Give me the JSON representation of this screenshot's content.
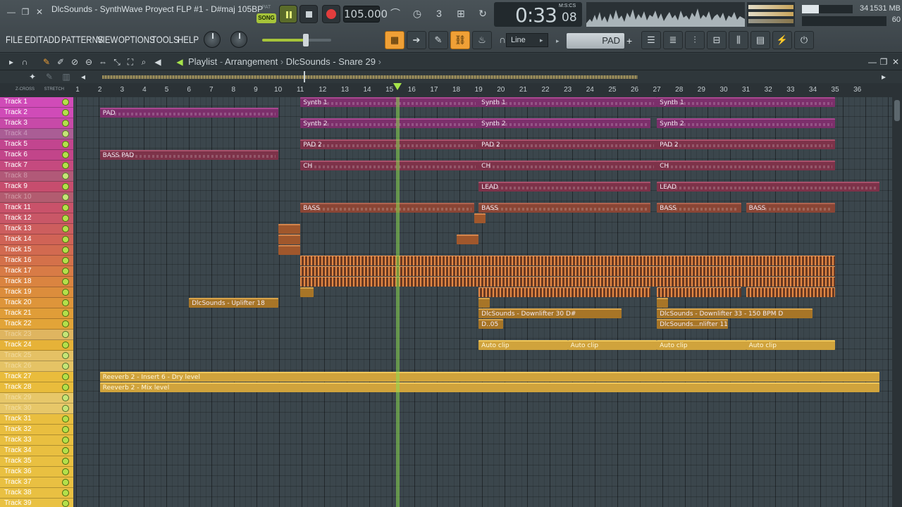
{
  "window": {
    "title": "DlcSounds - SynthWave Proyect FLP #1 - D#maj 105BP",
    "min_icon": "minimize-icon",
    "restore_icon": "restore-icon",
    "close_icon": "close-icon"
  },
  "transport": {
    "pat_label": "PAT",
    "song_label": "SONG",
    "tempo": "105.000",
    "time": "0:33",
    "time_frac": "08",
    "time_unit": "M:S:CS"
  },
  "stats": {
    "cpu": "34",
    "cpu_fill": 0.34,
    "memory": "1531 MB",
    "polyphony": "60"
  },
  "menu": [
    "FILE",
    "EDIT",
    "ADD",
    "PATTERNS",
    "VIEW",
    "OPTIONS",
    "TOOLS",
    "HELP"
  ],
  "toolbar": {
    "snap": "Line",
    "pattern": "PAD",
    "pattern_plus": "+"
  },
  "playlist": {
    "title": "Playlist",
    "section": "Arrangement",
    "selected": "DlcSounds - Snare 29",
    "ruler_labels": [
      "Z-CROSS",
      "STRETCH"
    ]
  },
  "ruler": [
    "1",
    "2",
    "3",
    "4",
    "5",
    "6",
    "7",
    "8",
    "9",
    "10",
    "11",
    "12",
    "13",
    "14",
    "15",
    "16",
    "17",
    "18",
    "19",
    "20",
    "21",
    "22",
    "23",
    "24",
    "25",
    "26",
    "27",
    "28",
    "29",
    "30",
    "31",
    "32",
    "33",
    "34",
    "35",
    "36"
  ],
  "tracks": [
    {
      "name": "Track 1",
      "color": "#d04bb8",
      "dim": false
    },
    {
      "name": "Track 2",
      "color": "#d04bb8",
      "dim": false
    },
    {
      "name": "Track 3",
      "color": "#c74aa8",
      "dim": false
    },
    {
      "name": "Track 4",
      "color": "#b9509c",
      "dim": true
    },
    {
      "name": "Track 5",
      "color": "#c2458f",
      "dim": false
    },
    {
      "name": "Track 6",
      "color": "#c2458a",
      "dim": false
    },
    {
      "name": "Track 7",
      "color": "#c54a7f",
      "dim": false
    },
    {
      "name": "Track 8",
      "color": "#c44c76",
      "dim": true
    },
    {
      "name": "Track 9",
      "color": "#c74d6e",
      "dim": false
    },
    {
      "name": "Track 10",
      "color": "#c5506a",
      "dim": true
    },
    {
      "name": "Track 11",
      "color": "#c9526a",
      "dim": false
    },
    {
      "name": "Track 12",
      "color": "#c95767",
      "dim": false
    },
    {
      "name": "Track 13",
      "color": "#cd5e5e",
      "dim": false
    },
    {
      "name": "Track 14",
      "color": "#d06356",
      "dim": false
    },
    {
      "name": "Track 15",
      "color": "#d26a50",
      "dim": false
    },
    {
      "name": "Track 16",
      "color": "#d4714a",
      "dim": false
    },
    {
      "name": "Track 17",
      "color": "#d87b46",
      "dim": false
    },
    {
      "name": "Track 18",
      "color": "#da8440",
      "dim": false
    },
    {
      "name": "Track 19",
      "color": "#dc8d3c",
      "dim": false
    },
    {
      "name": "Track 20",
      "color": "#de953a",
      "dim": false
    },
    {
      "name": "Track 21",
      "color": "#e09d38",
      "dim": false
    },
    {
      "name": "Track 22",
      "color": "#e2a438",
      "dim": false
    },
    {
      "name": "Track 23",
      "color": "#e4ab38",
      "dim": true
    },
    {
      "name": "Track 24",
      "color": "#e6b238",
      "dim": false
    },
    {
      "name": "Track 25",
      "color": "#e8b73a",
      "dim": true
    },
    {
      "name": "Track 26",
      "color": "#e8b93a",
      "dim": true
    },
    {
      "name": "Track 27",
      "color": "#e9bc3c",
      "dim": false
    },
    {
      "name": "Track 28",
      "color": "#e9bc3c",
      "dim": false
    },
    {
      "name": "Track 29",
      "color": "#e9bd3e",
      "dim": true
    },
    {
      "name": "Track 30",
      "color": "#e9bd3e",
      "dim": true
    },
    {
      "name": "Track 31",
      "color": "#e9be3f",
      "dim": false
    },
    {
      "name": "Track 32",
      "color": "#e9be3f",
      "dim": false
    },
    {
      "name": "Track 33",
      "color": "#e9bf40",
      "dim": false
    },
    {
      "name": "Track 34",
      "color": "#e9bf40",
      "dim": false
    },
    {
      "name": "Track 35",
      "color": "#e9c041",
      "dim": false
    },
    {
      "name": "Track 36",
      "color": "#e9c041",
      "dim": false
    },
    {
      "name": "Track 37",
      "color": "#e9c042",
      "dim": false
    },
    {
      "name": "Track 38",
      "color": "#e9c042",
      "dim": false
    },
    {
      "name": "Track 39",
      "color": "#e9c143",
      "dim": false
    }
  ],
  "clips": [
    {
      "track": 0,
      "start": 11,
      "end": 19,
      "label": "Synth 1",
      "style": "pink notes"
    },
    {
      "track": 0,
      "start": 19,
      "end": 27,
      "label": "Synth 1",
      "style": "pink notes"
    },
    {
      "track": 0,
      "start": 27,
      "end": 35,
      "label": "Synth 1",
      "style": "pink notes"
    },
    {
      "track": 1,
      "start": 2,
      "end": 10,
      "label": "PAD",
      "style": "pink notes"
    },
    {
      "track": 2,
      "start": 11,
      "end": 19,
      "label": "Synth 2",
      "style": "pink notes"
    },
    {
      "track": 2,
      "start": 19,
      "end": 26.7,
      "label": "Synth 2",
      "style": "pink notes"
    },
    {
      "track": 2,
      "start": 27,
      "end": 35,
      "label": "Synth 2",
      "style": "pink notes"
    },
    {
      "track": 4,
      "start": 11,
      "end": 19,
      "label": "PAD 2",
      "style": "rose notes"
    },
    {
      "track": 4,
      "start": 19,
      "end": 27,
      "label": "PAD 2",
      "style": "rose notes"
    },
    {
      "track": 4,
      "start": 27,
      "end": 35,
      "label": "PAD 2",
      "style": "rose notes"
    },
    {
      "track": 5,
      "start": 2,
      "end": 10,
      "label": "BASS PAD",
      "style": "rose notes"
    },
    {
      "track": 6,
      "start": 11,
      "end": 19,
      "label": "CH",
      "style": "rose notes"
    },
    {
      "track": 6,
      "start": 19,
      "end": 27,
      "label": "CH",
      "style": "rose notes"
    },
    {
      "track": 6,
      "start": 27,
      "end": 35,
      "label": "CH",
      "style": "rose notes"
    },
    {
      "track": 8,
      "start": 19,
      "end": 26.7,
      "label": "LEAD",
      "style": "rose notes"
    },
    {
      "track": 8,
      "start": 27,
      "end": 37,
      "label": "LEAD",
      "style": "rose notes"
    },
    {
      "track": 10,
      "start": 11,
      "end": 18.8,
      "label": "BASS",
      "style": "rust notes"
    },
    {
      "track": 10,
      "start": 19,
      "end": 26.7,
      "label": "BASS",
      "style": "rust notes"
    },
    {
      "track": 10,
      "start": 27,
      "end": 30.8,
      "label": "BASS",
      "style": "rust notes"
    },
    {
      "track": 10,
      "start": 31,
      "end": 35,
      "label": "BASS",
      "style": "rust notes"
    },
    {
      "track": 11,
      "start": 18.8,
      "end": 19.3,
      "label": "",
      "style": "orange"
    },
    {
      "track": 12,
      "start": 10,
      "end": 11,
      "label": "",
      "style": "orange"
    },
    {
      "track": 13,
      "start": 10,
      "end": 11,
      "label": "",
      "style": "orange"
    },
    {
      "track": 13,
      "start": 18,
      "end": 19,
      "label": "",
      "style": "orange"
    },
    {
      "track": 14,
      "start": 10,
      "end": 11,
      "label": "",
      "style": "orange"
    },
    {
      "track": 15,
      "start": 11,
      "end": 35,
      "label": "",
      "style": "ticks"
    },
    {
      "track": 16,
      "start": 11,
      "end": 35,
      "label": "",
      "style": "ticks"
    },
    {
      "track": 17,
      "start": 11,
      "end": 35,
      "label": "",
      "style": "ticks"
    },
    {
      "track": 18,
      "start": 11,
      "end": 11.6,
      "label": "",
      "style": "amber"
    },
    {
      "track": 18,
      "start": 19,
      "end": 26.7,
      "label": "",
      "style": "ticks"
    },
    {
      "track": 18,
      "start": 27,
      "end": 30.8,
      "label": "",
      "style": "ticks"
    },
    {
      "track": 18,
      "start": 31,
      "end": 35,
      "label": "",
      "style": "ticks"
    },
    {
      "track": 19,
      "start": 6,
      "end": 10,
      "label": "DlcSounds - Uplifter 18",
      "style": "amber"
    },
    {
      "track": 19,
      "start": 19,
      "end": 19.5,
      "label": "",
      "style": "amber"
    },
    {
      "track": 19,
      "start": 27,
      "end": 27.5,
      "label": "",
      "style": "amber"
    },
    {
      "track": 20,
      "start": 19,
      "end": 25.4,
      "label": "DlcSounds - Downlifter 30 D#",
      "style": "amber"
    },
    {
      "track": 20,
      "start": 27,
      "end": 34,
      "label": "DlcSounds - Downlifter 33 - 150 BPM D",
      "style": "amber"
    },
    {
      "track": 21,
      "start": 19,
      "end": 20.1,
      "label": "D..05",
      "style": "amber"
    },
    {
      "track": 21,
      "start": 27,
      "end": 30.2,
      "label": "DlcSounds...nlifter 11",
      "style": "amber"
    },
    {
      "track": 23,
      "start": 19,
      "end": 23,
      "label": "Auto clip",
      "style": "gold"
    },
    {
      "track": 23,
      "start": 23,
      "end": 27,
      "label": "Auto clip",
      "style": "gold"
    },
    {
      "track": 23,
      "start": 27,
      "end": 31,
      "label": "Auto clip",
      "style": "gold"
    },
    {
      "track": 23,
      "start": 31,
      "end": 35,
      "label": "Auto clip",
      "style": "gold"
    },
    {
      "track": 26,
      "start": 2,
      "end": 37,
      "label": "Reeverb 2 - Insert 6 - Dry level",
      "style": "gold"
    },
    {
      "track": 27,
      "start": 2,
      "end": 37,
      "label": "Reeverb 2 - Mix level",
      "style": "gold"
    }
  ],
  "playhead_bar": 15.3
}
